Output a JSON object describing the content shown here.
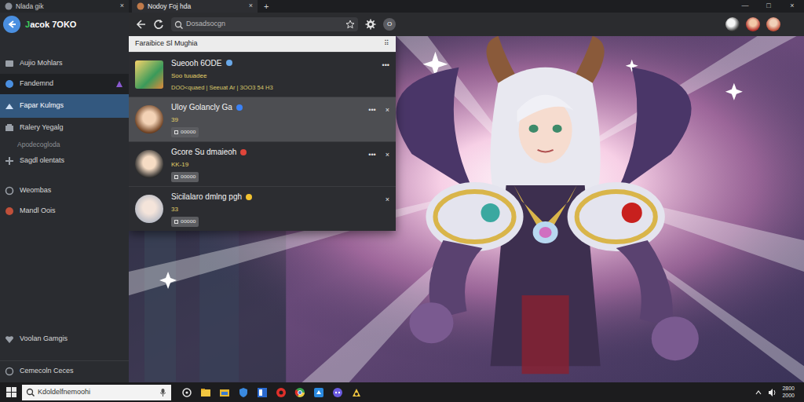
{
  "window": {
    "controls": [
      "—",
      "□",
      "×"
    ]
  },
  "tabs": [
    {
      "label": "Nlada gik",
      "selected": false,
      "close": "×"
    },
    {
      "label": "Nodoy Foj hda",
      "selected": true,
      "close": "×"
    }
  ],
  "new_tab": "+",
  "app": {
    "logo": "Jacok 7OKO"
  },
  "sidebar": {
    "items": [
      {
        "label": "Aujio Mohlars",
        "kind": "item",
        "selected": false,
        "hovered": false
      },
      {
        "label": "Fandemnd",
        "kind": "item",
        "selected": false,
        "hovered": true
      },
      {
        "label": "Fapar Kulmgs",
        "kind": "item",
        "selected": true,
        "hovered": false
      },
      {
        "label": "Ralery Yegalg",
        "kind": "item",
        "selected": false,
        "hovered": false
      },
      {
        "label": "Apodecogloda",
        "kind": "sub",
        "selected": false,
        "hovered": false
      },
      {
        "label": "Sagdl olentats",
        "kind": "item",
        "selected": false,
        "hovered": false
      },
      {
        "label": "Weombas",
        "kind": "item",
        "selected": false,
        "hovered": false
      },
      {
        "label": "Mandl Oois",
        "kind": "item",
        "selected": false,
        "hovered": false
      }
    ],
    "footer": [
      {
        "label": "Voolan Gamgis"
      },
      {
        "label": "Cemecoln Ceces"
      }
    ]
  },
  "toolbar": {
    "search": {
      "placeholder": "Dosadsocgn"
    },
    "profile": "O"
  },
  "panel": {
    "title": "Faraibice Sl Mughia",
    "menu": "⠿",
    "items": [
      {
        "title": "Sueooh 6ODE",
        "subtitle": "Soo tuuadee",
        "meta": "DOO<quaed | Seeuat Ar | 3OO3 54 H3",
        "tag": "",
        "kind": "detail",
        "selected": false,
        "actions": [
          "•••"
        ]
      },
      {
        "title": "Uloy Golancly Ga",
        "subtitle": "39",
        "meta": "",
        "tag": "ooooo",
        "kind": "tagged",
        "selected": true,
        "actions": [
          "•••",
          "×"
        ]
      },
      {
        "title": "Gcore Su dmaieoh",
        "subtitle": "KK-19",
        "meta": "",
        "tag": "ooooo",
        "kind": "tagged",
        "selected": false,
        "actions": [
          "•••",
          "×"
        ]
      },
      {
        "title": "Sicilalaro dmlng pgh",
        "subtitle": "33",
        "meta": "",
        "tag": "ooooo",
        "kind": "tagged",
        "selected": false,
        "actions": [
          "×"
        ]
      }
    ]
  },
  "taskbar": {
    "search": {
      "placeholder": "Kdoldelfnemoohi"
    },
    "time": "2800",
    "date": "2000"
  }
}
